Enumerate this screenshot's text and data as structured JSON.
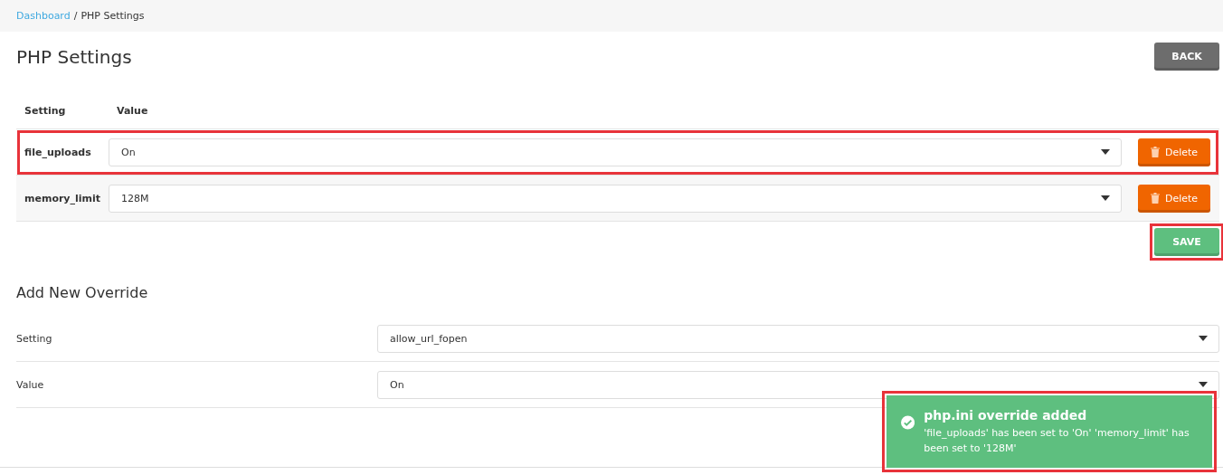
{
  "breadcrumb": {
    "link": "Dashboard",
    "separator": "/",
    "current": "PHP Settings"
  },
  "title": "PHP Settings",
  "back_button": "BACK",
  "table": {
    "columns": [
      "Setting",
      "Value"
    ],
    "rows": [
      {
        "setting": "file_uploads",
        "value": "On",
        "action": "Delete",
        "highlighted": true
      },
      {
        "setting": "memory_limit",
        "value": "128M",
        "action": "Delete",
        "highlighted": false
      }
    ]
  },
  "save_button": {
    "label": "SAVE",
    "highlighted": true
  },
  "add_override": {
    "title": "Add New Override",
    "fields": [
      {
        "label": "Setting",
        "value": "allow_url_fopen"
      },
      {
        "label": "Value",
        "value": "On"
      }
    ]
  },
  "toast": {
    "title": "php.ini override added",
    "message": "'file_uploads' has been set to 'On' 'memory_limit' has been set to '128M'",
    "highlighted": true
  }
}
